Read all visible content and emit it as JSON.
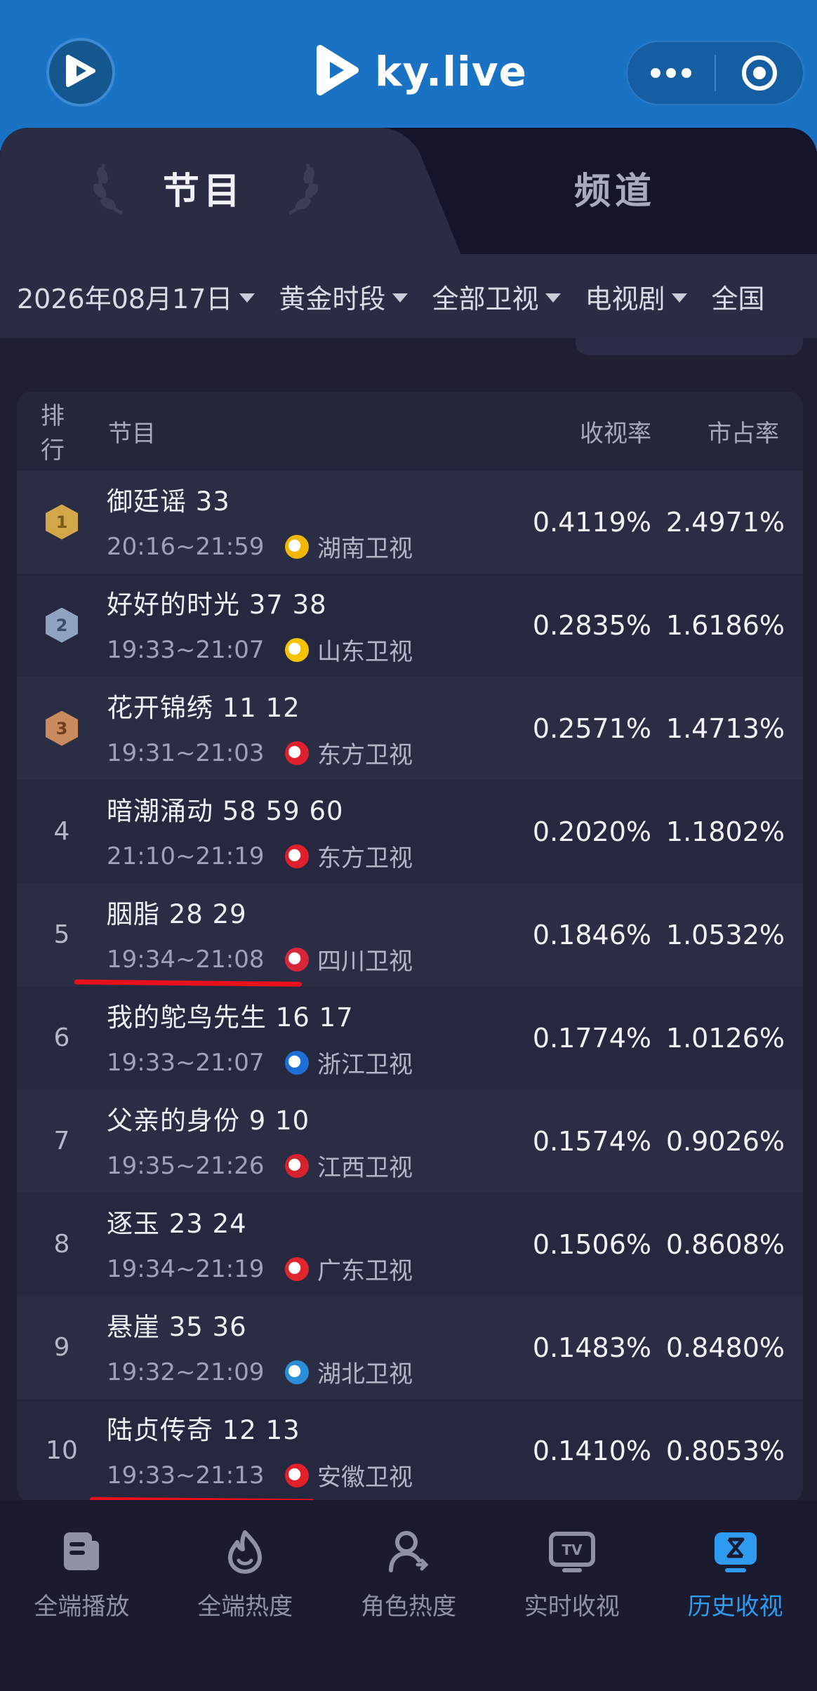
{
  "header": {
    "app_name": "ky.live"
  },
  "tabs": [
    {
      "label": "节目",
      "active": true
    },
    {
      "label": "频道",
      "active": false
    }
  ],
  "filters": [
    {
      "label": "2026年08月17日"
    },
    {
      "label": "黄金时段"
    },
    {
      "label": "全部卫视"
    },
    {
      "label": "电视剧"
    },
    {
      "label": "全国"
    }
  ],
  "table": {
    "headers": {
      "rank": "排行",
      "program": "节目",
      "rating": "收视率",
      "share": "市占率"
    },
    "rows": [
      {
        "rank": "1",
        "title": "御廷谣 33",
        "time": "20:16~21:59",
        "channel": "湖南卫视",
        "channel_color": "#f2b705",
        "rating": "0.4119%",
        "share": "2.4971%"
      },
      {
        "rank": "2",
        "title": "好好的时光 37 38",
        "time": "19:33~21:07",
        "channel": "山东卫视",
        "channel_color": "#f5c400",
        "rating": "0.2835%",
        "share": "1.6186%"
      },
      {
        "rank": "3",
        "title": "花开锦绣 11 12",
        "time": "19:31~21:03",
        "channel": "东方卫视",
        "channel_color": "#e01f2d",
        "rating": "0.2571%",
        "share": "1.4713%"
      },
      {
        "rank": "4",
        "title": "暗潮涌动 58 59 60",
        "time": "21:10~21:19",
        "channel": "东方卫视",
        "channel_color": "#e01f2d",
        "rating": "0.2020%",
        "share": "1.1802%"
      },
      {
        "rank": "5",
        "title": "胭脂 28 29",
        "time": "19:34~21:08",
        "channel": "四川卫视",
        "channel_color": "#d9263a",
        "rating": "0.1846%",
        "share": "1.0532%"
      },
      {
        "rank": "6",
        "title": "我的鸵鸟先生 16 17",
        "time": "19:33~21:07",
        "channel": "浙江卫视",
        "channel_color": "#1d6fd6",
        "rating": "0.1774%",
        "share": "1.0126%"
      },
      {
        "rank": "7",
        "title": "父亲的身份 9 10",
        "time": "19:35~21:26",
        "channel": "江西卫视",
        "channel_color": "#d4232e",
        "rating": "0.1574%",
        "share": "0.9026%"
      },
      {
        "rank": "8",
        "title": "逐玉 23 24",
        "time": "19:34~21:19",
        "channel": "广东卫视",
        "channel_color": "#e0262c",
        "rating": "0.1506%",
        "share": "0.8608%"
      },
      {
        "rank": "9",
        "title": "悬崖 35 36",
        "time": "19:32~21:09",
        "channel": "湖北卫视",
        "channel_color": "#2a8fd8",
        "rating": "0.1483%",
        "share": "0.8480%"
      },
      {
        "rank": "10",
        "title": "陆贞传奇 12 13",
        "time": "19:33~21:13",
        "channel": "安徽卫视",
        "channel_color": "#e0202a",
        "rating": "0.1410%",
        "share": "0.8053%"
      }
    ]
  },
  "bottom_nav": [
    {
      "label": "全端播放",
      "icon": "document-icon",
      "active": false
    },
    {
      "label": "全端热度",
      "icon": "flame-icon",
      "active": false
    },
    {
      "label": "角色热度",
      "icon": "user-icon",
      "active": false
    },
    {
      "label": "实时收视",
      "icon": "tv-icon",
      "active": false
    },
    {
      "label": "历史收视",
      "icon": "history-icon",
      "active": true
    }
  ],
  "colors": {
    "accent": "#2e9bf0",
    "header_bg": "#1a72c4",
    "highlight_line": "#e8101a"
  },
  "watermark": "ky.live"
}
